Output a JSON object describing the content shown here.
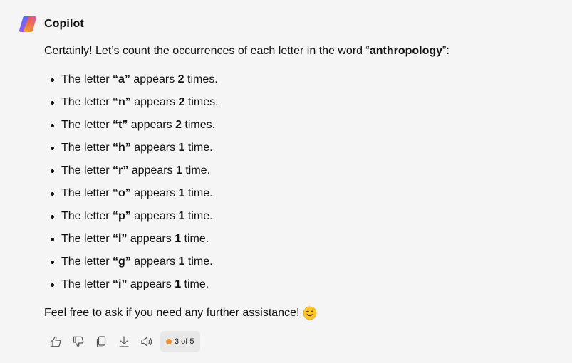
{
  "header": {
    "app_name": "Copilot",
    "logo_icon": "copilot-logo-icon"
  },
  "message": {
    "intro_prefix": "Certainly! Let’s count the occurrences of each letter in the word “",
    "word": "anthropology",
    "intro_suffix": "”:",
    "items": [
      {
        "prefix": "The letter ",
        "letter": "“a”",
        "middle": " appears ",
        "count": "2",
        "suffix": " times."
      },
      {
        "prefix": "The letter ",
        "letter": "“n”",
        "middle": " appears ",
        "count": "2",
        "suffix": " times."
      },
      {
        "prefix": "The letter ",
        "letter": "“t”",
        "middle": " appears ",
        "count": "2",
        "suffix": " times."
      },
      {
        "prefix": "The letter ",
        "letter": "“h”",
        "middle": " appears ",
        "count": "1",
        "suffix": " time."
      },
      {
        "prefix": "The letter ",
        "letter": "“r”",
        "middle": " appears ",
        "count": "1",
        "suffix": " time."
      },
      {
        "prefix": "The letter ",
        "letter": "“o”",
        "middle": " appears ",
        "count": "1",
        "suffix": " time."
      },
      {
        "prefix": "The letter ",
        "letter": "“p”",
        "middle": " appears ",
        "count": "1",
        "suffix": " time."
      },
      {
        "prefix": "The letter ",
        "letter": "“l”",
        "middle": " appears ",
        "count": "1",
        "suffix": " time."
      },
      {
        "prefix": "The letter ",
        "letter": "“g”",
        "middle": " appears ",
        "count": "1",
        "suffix": " time."
      },
      {
        "prefix": "The letter ",
        "letter": "“i”",
        "middle": " appears ",
        "count": "1",
        "suffix": " time."
      }
    ],
    "outro": "Feel free to ask if you need any further assistance!",
    "outro_emoji": "smiling-face-emoji"
  },
  "actions": {
    "icons": [
      "thumbs-up-icon",
      "thumbs-down-icon",
      "copy-icon",
      "download-icon",
      "speaker-icon"
    ],
    "page_indicator": "3 of 5",
    "indicator_dot_color": "#f0902a"
  }
}
